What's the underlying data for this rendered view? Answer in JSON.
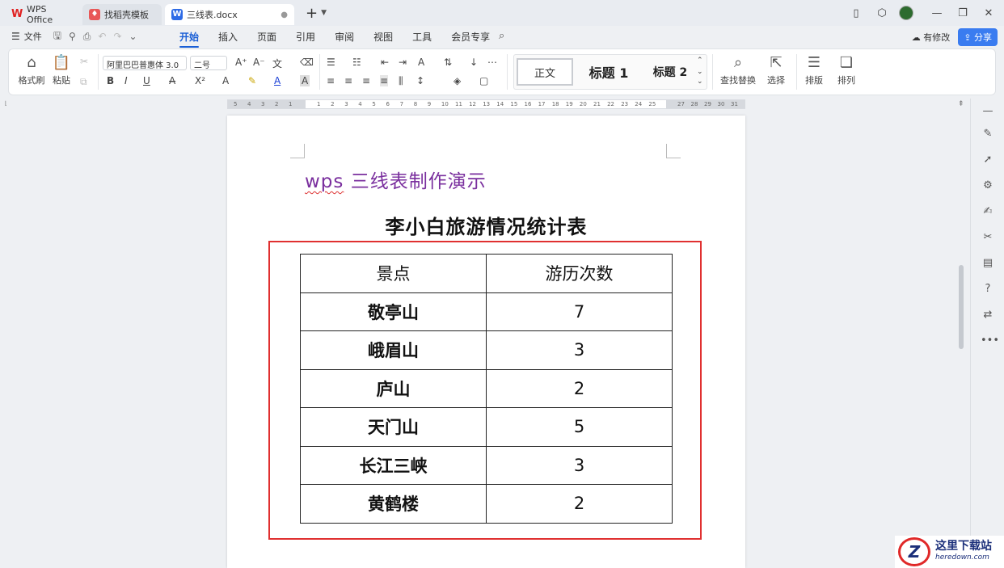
{
  "tabs": [
    {
      "label": "WPS Office",
      "icon": "wps-logo-icon"
    },
    {
      "label": "找稻壳模板",
      "icon": "daoke-icon"
    },
    {
      "label": "三线表.docx",
      "icon": "word-doc-icon"
    }
  ],
  "menu": {
    "file": "文件",
    "items": [
      "开始",
      "插入",
      "页面",
      "引用",
      "审阅",
      "视图",
      "工具",
      "会员专享"
    ],
    "active": "开始",
    "modified": "有修改",
    "share": "分享"
  },
  "ribbon": {
    "format_painter": "格式刷",
    "paste": "粘贴",
    "font_name": "阿里巴巴普惠体 3.0",
    "font_size": "二号",
    "styles": [
      "正文",
      "标题 1",
      "标题 2"
    ],
    "find_replace": "查找替换",
    "select": "选择",
    "layout": "排版",
    "arrange": "排列"
  },
  "ruler": {
    "left_numbers": [
      "5",
      "4",
      "3",
      "2",
      "1"
    ],
    "numbers": [
      "1",
      "2",
      "3",
      "4",
      "5",
      "6",
      "7",
      "8",
      "9",
      "10",
      "11",
      "12",
      "13",
      "14",
      "15",
      "16",
      "17",
      "18",
      "19",
      "20",
      "21",
      "22",
      "23",
      "24",
      "25"
    ],
    "right_numbers": [
      "27",
      "28",
      "29",
      "30",
      "31"
    ]
  },
  "document": {
    "heading_prefix": "wps",
    "heading_rest": " 三线表制作演示",
    "table_title": "李小白旅游情况统计表",
    "table": {
      "headers": [
        "景点",
        "游历次数"
      ],
      "rows": [
        [
          "敬亭山",
          "7"
        ],
        [
          "峨眉山",
          "3"
        ],
        [
          "庐山",
          "2"
        ],
        [
          "天门山",
          "5"
        ],
        [
          "长江三峡",
          "3"
        ],
        [
          "黄鹤楼",
          "2"
        ]
      ]
    }
  },
  "watermark": {
    "cn": "这里下载站",
    "en": "heredown.com"
  },
  "colors": {
    "accent": "#1a5fd6",
    "heading": "#7a2f9e",
    "frame": "#e03030"
  }
}
